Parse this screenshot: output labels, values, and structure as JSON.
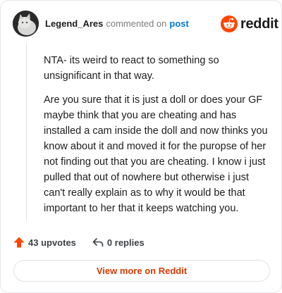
{
  "header": {
    "username": "Legend_Ares",
    "action_text": "commented on",
    "link_text": "post",
    "logo_text": "reddit"
  },
  "comment": {
    "paragraphs": [
      "NTA- its weird to react to something so unsignificant in that way.",
      "Are you sure that it is just a doll or does your GF maybe think that you are cheating and has installed a cam inside the doll and now thinks you know about it and moved it for the puropse of her not finding out that you are cheating. I know i just pulled that out of nowhere but otherwise i just can't really explain as to why it would be that important to her that it keeps watching you."
    ]
  },
  "actions": {
    "upvotes_label": "43 upvotes",
    "replies_label": "0 replies"
  },
  "footer": {
    "view_more_label": "View more on Reddit"
  },
  "colors": {
    "brand": "#ff4500",
    "link": "#0079d3",
    "view_more": "#d93900"
  },
  "icons": {
    "upvote": "upvote-arrow-icon",
    "reply": "reply-arrow-icon",
    "logo": "reddit-snoo-icon"
  }
}
